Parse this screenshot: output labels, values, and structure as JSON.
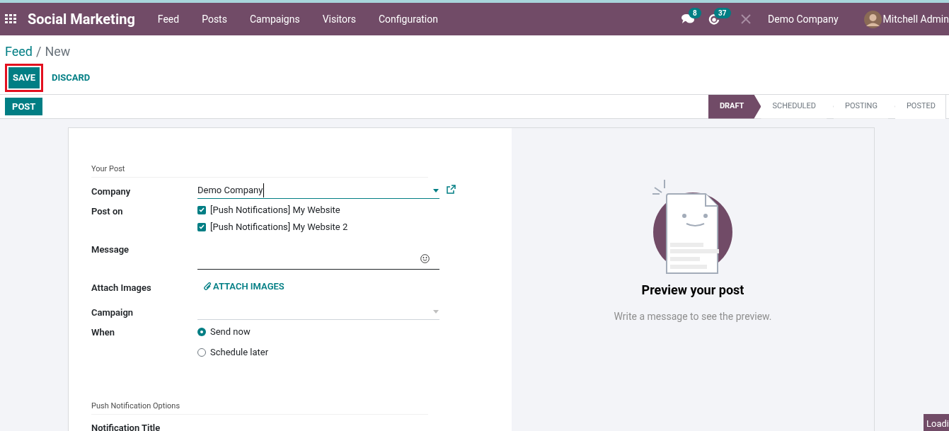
{
  "navbar": {
    "app_name": "Social Marketing",
    "menu": [
      "Feed",
      "Posts",
      "Campaigns",
      "Visitors",
      "Configuration"
    ],
    "chat_badge": "8",
    "activity_badge": "37",
    "company": "Demo Company",
    "user": "Mitchell Admin"
  },
  "breadcrumb": {
    "parent": "Feed",
    "separator": "/",
    "current": "New"
  },
  "actions": {
    "save": "SAVE",
    "discard": "DISCARD"
  },
  "post_button": "POST",
  "stages": [
    {
      "label": "DRAFT",
      "selected": true
    },
    {
      "label": "SCHEDULED",
      "selected": false
    },
    {
      "label": "POSTING",
      "selected": false
    },
    {
      "label": "POSTED",
      "selected": false
    }
  ],
  "form": {
    "section_title": "Your Post",
    "fields": [
      {
        "kind": "select",
        "label": "Company",
        "value": "Demo Company"
      },
      {
        "kind": "checkboxes",
        "label": "Post on",
        "options": [
          {
            "label": "[Push Notifications] My Website",
            "checked": true
          },
          {
            "label": "[Push Notifications] My Website 2",
            "checked": true
          }
        ]
      },
      {
        "kind": "textarea",
        "label": "Message"
      },
      {
        "kind": "attach",
        "label": "Attach Images",
        "button": "ATTACH IMAGES"
      },
      {
        "kind": "select",
        "label": "Campaign"
      },
      {
        "kind": "radios",
        "label": "When",
        "options": [
          {
            "label": "Send now",
            "selected": true
          },
          {
            "label": "Schedule later",
            "selected": false
          }
        ]
      }
    ],
    "section2_title": "Push Notification Options",
    "next_label": "Notification Title"
  },
  "preview": {
    "title": "Preview your post",
    "hint": "Write a message to see the preview."
  },
  "loading": "Loadi"
}
